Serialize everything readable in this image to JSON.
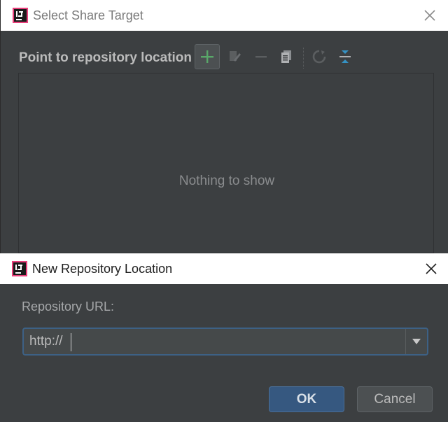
{
  "outer_dialog": {
    "title": "Select Share Target",
    "toolbar_label": "Point to repository location",
    "toolbar_icons": [
      "add-icon",
      "edit-icon",
      "remove-icon",
      "copy-icon",
      "refresh-icon",
      "collapse-icon"
    ],
    "empty_text": "Nothing to show"
  },
  "inner_dialog": {
    "title": "New Repository Location",
    "url_label": "Repository URL:",
    "url_value": "http://",
    "ok_label": "OK",
    "cancel_label": "Cancel"
  },
  "colors": {
    "background": "#3c3f41",
    "accent_add": "#59a869",
    "primary_button": "#365880",
    "focus_border": "#3d6185"
  }
}
